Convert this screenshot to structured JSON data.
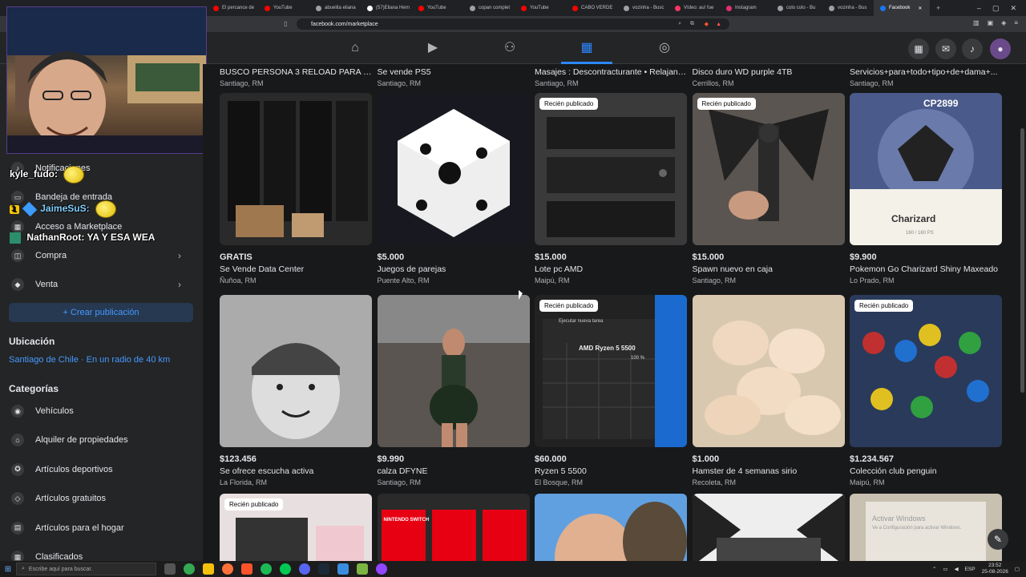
{
  "browser": {
    "tabs": [
      {
        "label": "El percance de",
        "color": "#ff0000"
      },
      {
        "label": "YouTube",
        "color": "#ff0000"
      },
      {
        "label": "abuelita eliana",
        "color": "#9aa0a6"
      },
      {
        "label": "(57)Eliana Hern",
        "color": "#ffffff"
      },
      {
        "label": "YouTube",
        "color": "#ff0000"
      },
      {
        "label": "copan complet",
        "color": "#9aa0a6"
      },
      {
        "label": "YouTube",
        "color": "#ff0000"
      },
      {
        "label": "CABO VERDE",
        "color": "#ff0000"
      },
      {
        "label": "vozinha - Busc",
        "color": "#9aa0a6"
      },
      {
        "label": "Vídeo: au! fue",
        "color": "#ff3366"
      },
      {
        "label": "Instagram",
        "color": "#e1306c"
      },
      {
        "label": "colo colo - Bu",
        "color": "#9aa0a6"
      },
      {
        "label": "vozinha - Bus",
        "color": "#9aa0a6"
      },
      {
        "label": "Facebook",
        "color": "#1877f2"
      }
    ],
    "url": "facebook.com/marketplace"
  },
  "fb_nav": {
    "icons": [
      "home-icon",
      "watch-icon",
      "groups-icon",
      "marketplace-icon",
      "gaming-icon"
    ],
    "right_icons": [
      "menu-grid-icon",
      "messenger-icon",
      "bell-icon",
      "avatar"
    ]
  },
  "overlay": {
    "chat": [
      {
        "user": "kyle_fudo:",
        "msg": ""
      },
      {
        "user": "JaimeSuS:",
        "msg": ""
      },
      {
        "user": "NathanRoot:",
        "msg": "YA Y ESA WEA"
      }
    ],
    "badge_num": "1"
  },
  "sidebar": {
    "items_top": [
      {
        "label": "Notificaciones",
        "icon": "bell-icon"
      },
      {
        "label": "Bandeja de entrada",
        "icon": "inbox-icon"
      },
      {
        "label": "Acceso a Marketplace",
        "icon": "marketplace-icon"
      },
      {
        "label": "Compra",
        "icon": "bag-icon"
      },
      {
        "label": "Venta",
        "icon": "tag-icon"
      }
    ],
    "create_label": "+ Crear publicación",
    "location_title": "Ubicación",
    "location_value": "Santiago de Chile · En un radio de 40 km",
    "categories_title": "Categorías",
    "categories": [
      {
        "label": "Vehículos",
        "icon": "car-icon"
      },
      {
        "label": "Alquiler de propiedades",
        "icon": "house-icon"
      },
      {
        "label": "Artículos deportivos",
        "icon": "sports-icon"
      },
      {
        "label": "Artículos gratuitos",
        "icon": "free-tag-icon"
      },
      {
        "label": "Artículos para el hogar",
        "icon": "home-goods-icon"
      },
      {
        "label": "Clasificados",
        "icon": "classified-icon"
      }
    ]
  },
  "listings_top": [
    {
      "title": "BUSCO PERSONA 3 RELOAD PARA LA P...",
      "loc": "Santiago, RM"
    },
    {
      "title": "Se vende PS5",
      "loc": "Santiago, RM"
    },
    {
      "title": "Masajes : Descontracturante • Relajante...",
      "loc": "Santiago, RM"
    },
    {
      "title": "Disco duro WD purple 4TB",
      "loc": "Cerrillos, RM"
    },
    {
      "title": "Servicios+para+todo+tipo+de+dama+...",
      "loc": "Santiago, RM"
    }
  ],
  "listings_row1": [
    {
      "price": "GRATIS",
      "title": "Se Vende Data Center",
      "loc": "Ñuñoa, RM",
      "badge": ""
    },
    {
      "price": "$5.000",
      "title": "Juegos de parejas",
      "loc": "Puente Alto, RM",
      "badge": ""
    },
    {
      "price": "$15.000",
      "title": "Lote pc AMD",
      "loc": "Maipú, RM",
      "badge": "Recién publicado"
    },
    {
      "price": "$15.000",
      "title": "Spawn nuevo en caja",
      "loc": "Santiago, RM",
      "badge": "Recién publicado"
    },
    {
      "price": "$9.900",
      "title": "Pokemon Go Charizard Shiny Maxeado",
      "loc": "Lo Prado, RM",
      "badge": ""
    }
  ],
  "listings_row2": [
    {
      "price": "$123.456",
      "title": "Se ofrece escucha activa",
      "loc": "La Florida, RM",
      "badge": ""
    },
    {
      "price": "$9.990",
      "title": "calza DFYNE",
      "loc": "Santiago, RM",
      "badge": ""
    },
    {
      "price": "$60.000",
      "title": "Ryzen 5 5500",
      "loc": "El Bosque, RM",
      "badge": "Recién publicado"
    },
    {
      "price": "$1.000",
      "title": "Hamster de 4 semanas sirio",
      "loc": "Recoleta, RM",
      "badge": ""
    },
    {
      "price": "$1.234.567",
      "title": "Colección club penguin",
      "loc": "Maipú, RM",
      "badge": "Recién publicado"
    }
  ],
  "listings_row3": [
    {
      "badge": "Recién publicado"
    },
    {
      "badge": ""
    },
    {
      "badge": ""
    },
    {
      "badge": ""
    },
    {
      "badge": ""
    }
  ],
  "image_text": {
    "pokemon_cp": "CP2899",
    "pokemon_name": "Charizard",
    "pokemon_hp": "160 / 160 PS",
    "cpu_text": "AMD Ryzen 5 5500",
    "cpu_title": "Ejecutar nueva tarea",
    "cpu_pct": "100 %",
    "switch": "NINTENDO SWITCH",
    "windows_watermark": "Activar Windows",
    "windows_sub": "Ve a Configuración para activar Windows."
  },
  "taskbar": {
    "search_placeholder": "Escribe aquí para buscar.",
    "lang": "ESP",
    "time": "23:52",
    "date": "25-08-2026"
  }
}
